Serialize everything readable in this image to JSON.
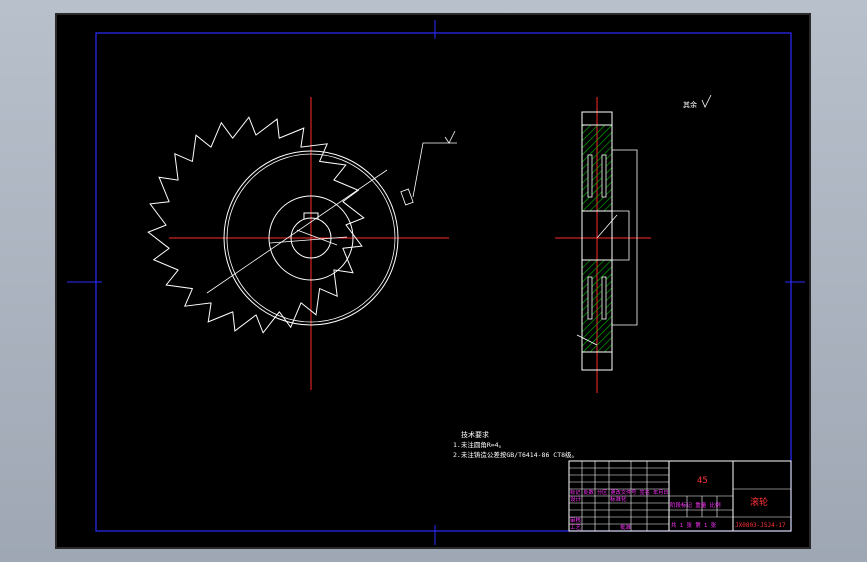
{
  "drawing": {
    "notes_title": "技术要求",
    "notes": [
      "1.未注圆角R=4。",
      "2.未注铸造公差按GB/T6414-86 CT8级。"
    ],
    "surface_symbol_label": "其余",
    "title_block": {
      "material": "45",
      "part_name": "滚轮",
      "drawing_number": "JX0803-JSJ4-17",
      "row1": "标记 处数 分区 更改文件号 签名 年月日",
      "design_label": "设计",
      "standardize_label": "标准化",
      "stage_label": "阶段标记 重量 比例",
      "review_label": "审核",
      "process_label": "工艺",
      "approve_label": "批准",
      "sheet_label": "共 1 张 第 1 张"
    },
    "colors": {
      "background": "#000000",
      "frame": "#0000ff",
      "centerline": "#ff0000",
      "geometry": "#ffffff",
      "title_block_text": "#ff00ff",
      "section_hatch": "#00aa00"
    }
  }
}
